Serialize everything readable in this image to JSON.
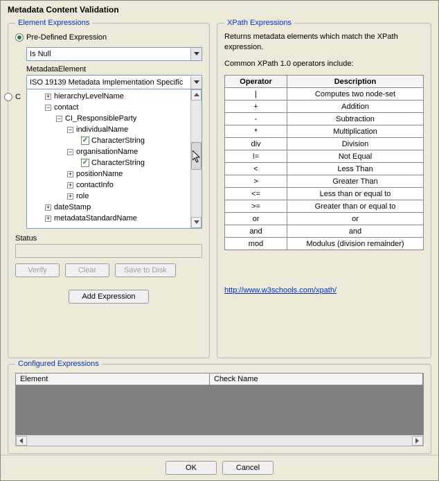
{
  "window_title": "Metadata Content Validation",
  "left": {
    "title": "Element Expressions",
    "radio_predefined": "Pre-Defined Expression",
    "predefined_value": "Is Null",
    "metadata_element_label": "MetadataElement",
    "tree_header": "ISO 19139 Metadata Implementation Specific",
    "radio_custom": "C",
    "tree": [
      {
        "indent": 26,
        "exp": "+",
        "label": "hierarchyLevelName"
      },
      {
        "indent": 26,
        "exp": "−",
        "label": "contact"
      },
      {
        "indent": 42,
        "exp": "−",
        "label": "CI_ResponsibleParty"
      },
      {
        "indent": 58,
        "exp": "−",
        "label": "individualName"
      },
      {
        "indent": 78,
        "cb": true,
        "label": "CharacterString"
      },
      {
        "indent": 58,
        "exp": "−",
        "label": "organisationName"
      },
      {
        "indent": 78,
        "cb": true,
        "label": "CharacterString"
      },
      {
        "indent": 58,
        "exp": "+",
        "label": "positionName"
      },
      {
        "indent": 58,
        "exp": "+",
        "label": "contactInfo"
      },
      {
        "indent": 58,
        "exp": "+",
        "label": "role"
      },
      {
        "indent": 26,
        "exp": "+",
        "label": "dateStamp"
      },
      {
        "indent": 26,
        "exp": "+",
        "label": "metadataStandardName"
      }
    ],
    "status_label": "Status",
    "verify_btn": "Verify",
    "clear_btn": "Clear",
    "save_btn": "Save to Disk",
    "add_btn": "Add Expression"
  },
  "right": {
    "title": "XPath Expressions",
    "desc1": "Returns metadata elements which match the XPath expression.",
    "desc2": "Common XPath 1.0 operators include:",
    "cols": {
      "op": "Operator",
      "desc": "Description"
    },
    "rows": [
      {
        "op": "|",
        "desc": "Computes two node-set"
      },
      {
        "op": "+",
        "desc": "Addition"
      },
      {
        "op": "-",
        "desc": "Subtraction"
      },
      {
        "op": "*",
        "desc": "Multiplication"
      },
      {
        "op": "div",
        "desc": "Division"
      },
      {
        "op": "!=",
        "desc": "Not Equal"
      },
      {
        "op": "<",
        "desc": "Less Than"
      },
      {
        "op": ">",
        "desc": "Greater Than"
      },
      {
        "op": "<=",
        "desc": "Less than or equal to"
      },
      {
        "op": ">=",
        "desc": "Greater than or equal to"
      },
      {
        "op": "or",
        "desc": "or"
      },
      {
        "op": "and",
        "desc": "and"
      },
      {
        "op": "mod",
        "desc": "Modulus (division remainder)"
      }
    ],
    "link": "http://www.w3schools.com/xpath/"
  },
  "configured": {
    "title": "Configured Expressions",
    "col_element": "Element",
    "col_check": "Check Name"
  },
  "buttons": {
    "ok": "OK",
    "cancel": "Cancel"
  }
}
